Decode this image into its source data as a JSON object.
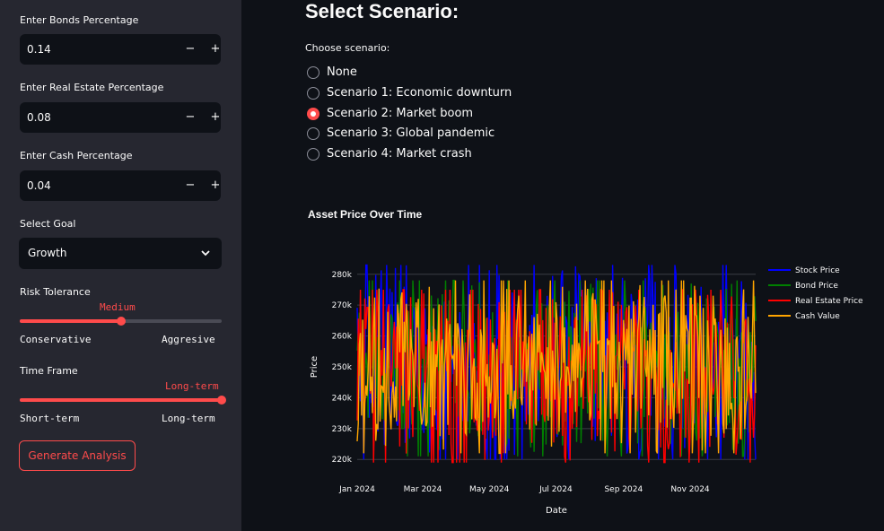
{
  "sidebar": {
    "bonds": {
      "label": "Enter Bonds Percentage",
      "value": "0.14"
    },
    "real_estate": {
      "label": "Enter Real Estate Percentage",
      "value": "0.08"
    },
    "cash": {
      "label": "Enter Cash Percentage",
      "value": "0.04"
    },
    "goal": {
      "label": "Select Goal",
      "value": "Growth"
    },
    "risk": {
      "label": "Risk Tolerance",
      "value": "Medium",
      "min_label": "Conservative",
      "max_label": "Aggresive",
      "level": 0.5
    },
    "timeframe": {
      "label": "Time Frame",
      "value": "Long-term",
      "min_label": "Short-term",
      "max_label": "Long-term",
      "level": 1.0
    },
    "generate_label": "Generate Analysis",
    "minus": "−",
    "plus": "+"
  },
  "main": {
    "title": "Select Scenario:",
    "radio_label": "Choose scenario:",
    "options": [
      {
        "label": "None",
        "selected": false
      },
      {
        "label": "Scenario 1: Economic downturn",
        "selected": false
      },
      {
        "label": "Scenario 2: Market boom",
        "selected": true
      },
      {
        "label": "Scenario 3: Global pandemic",
        "selected": false
      },
      {
        "label": "Scenario 4: Market crash",
        "selected": false
      }
    ]
  },
  "colors": {
    "accent": "#ff4b4b",
    "sidebar_bg": "#262730",
    "page_bg": "#0e1117"
  },
  "chart_data": {
    "type": "line",
    "title": "Asset Price Over Time",
    "xlabel": "Date",
    "ylabel": "Price",
    "x_ticks": [
      "Jan 2024",
      "Mar 2024",
      "May 2024",
      "Jul 2024",
      "Sep 2024",
      "Nov 2024"
    ],
    "y_ticks": [
      "220k",
      "230k",
      "240k",
      "250k",
      "260k",
      "270k",
      "280k"
    ],
    "ylim": [
      216000,
      284000
    ],
    "x_range": [
      "2024-01-01",
      "2024-12-31"
    ],
    "grid": true,
    "legend_position": "right",
    "series": [
      {
        "name": "Stock Price",
        "color": "#0000ff",
        "mean": 250000,
        "range": [
          220000,
          283000
        ]
      },
      {
        "name": "Bond Price",
        "color": "#008000",
        "mean": 250000,
        "range": [
          221000,
          278000
        ]
      },
      {
        "name": "Real Estate Price",
        "color": "#ff0000",
        "mean": 250000,
        "range": [
          219000,
          275000
        ]
      },
      {
        "name": "Cash Value",
        "color": "#ffa500",
        "mean": 250000,
        "range": [
          222000,
          278000
        ]
      }
    ]
  }
}
